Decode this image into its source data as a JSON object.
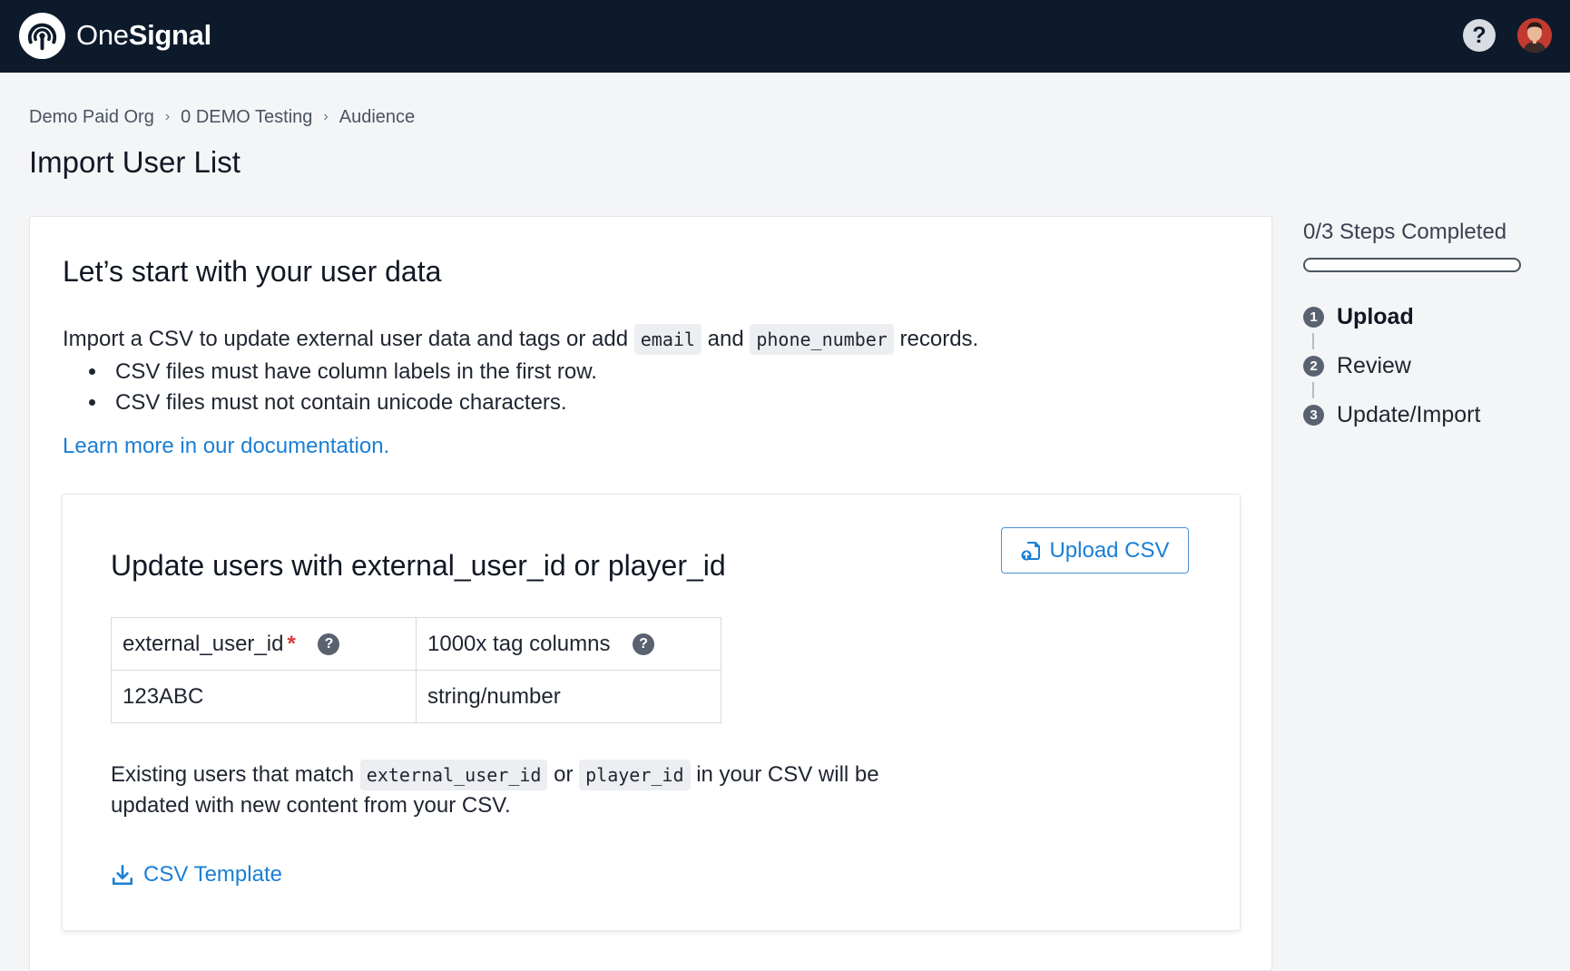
{
  "header": {
    "brand_part1": "One",
    "brand_part2": "Signal",
    "help_label": "?"
  },
  "breadcrumb": [
    {
      "label": "Demo Paid Org"
    },
    {
      "label": "0 DEMO Testing"
    },
    {
      "label": "Audience"
    }
  ],
  "page_title": "Import User List",
  "card": {
    "heading": "Let’s start with your user data",
    "intro_before": "Import a CSV to update external user data and tags or add",
    "intro_code1": "email",
    "intro_and": "and",
    "intro_code2": "phone_number",
    "intro_after": "records.",
    "bullets": [
      "CSV files must have column labels in the first row.",
      "CSV files must not contain unicode characters."
    ],
    "doc_link": "Learn more in our documentation."
  },
  "update_section": {
    "heading": "Update users with external_user_id or player_id",
    "upload_button": "Upload CSV",
    "table": {
      "header": [
        "external_user_id",
        "1000x tag columns"
      ],
      "required_mark": "*",
      "help_icon": "?",
      "row": [
        "123ABC",
        "string/number"
      ]
    },
    "existing_before": "Existing users that match",
    "existing_code1": "external_user_id",
    "existing_or": "or",
    "existing_code2": "player_id",
    "existing_after": "in your CSV will be updated with new content from your CSV.",
    "template_link": "CSV Template"
  },
  "steps": {
    "summary": "0/3 Steps Completed",
    "progress": 0,
    "items": [
      {
        "num": "1",
        "label": "Upload"
      },
      {
        "num": "2",
        "label": "Review"
      },
      {
        "num": "3",
        "label": "Update/Import"
      }
    ]
  },
  "colors": {
    "header_bg": "#0c1a2b",
    "link": "#1a7fd6",
    "required": "#d43b3b"
  }
}
